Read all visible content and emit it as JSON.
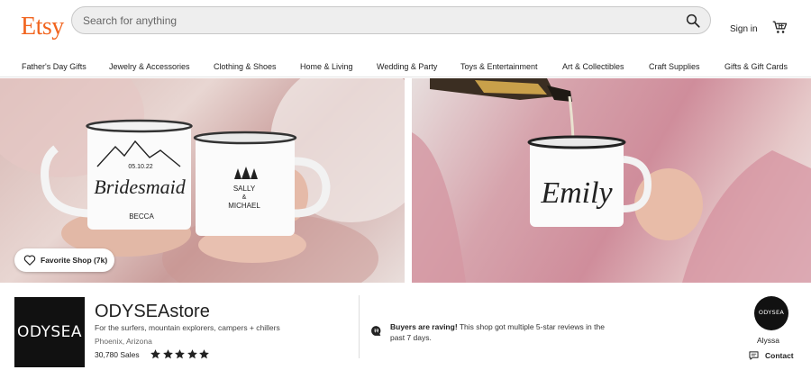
{
  "header": {
    "logo": "Etsy",
    "search_placeholder": "Search for anything",
    "sign_in": "Sign in"
  },
  "nav": {
    "items": [
      "Father's Day Gifts",
      "Jewelry & Accessories",
      "Clothing & Shoes",
      "Home & Living",
      "Wedding & Party",
      "Toys & Entertainment",
      "Art & Collectibles",
      "Craft Supplies",
      "Gifts & Gift Cards"
    ]
  },
  "hero": {
    "favorite_label": "Favorite Shop (7k)",
    "left_mug_a": {
      "date": "05.10.22",
      "title": "Bridesmaid",
      "name": "BECCA"
    },
    "left_mug_b": {
      "line1": "SALLY",
      "line2": "&",
      "line3": "MICHAEL"
    },
    "right_mug": {
      "name": "Emily"
    }
  },
  "shop": {
    "logo_text": "ODYSEA",
    "name": "ODYSEAstore",
    "tagline": "For the surfers, mountain explorers, campers + chillers",
    "location": "Phoenix, Arizona",
    "sales": "30,780 Sales",
    "rating_stars": 5,
    "rave_bold": "Buyers are raving!",
    "rave_text": " This shop got multiple 5-star reviews in the past 7 days.",
    "owner_avatar_text": "ODYSEA",
    "owner_name": "Alyssa",
    "contact_label": "Contact"
  },
  "colors": {
    "brand": "#f1641e",
    "star": "#222222"
  }
}
